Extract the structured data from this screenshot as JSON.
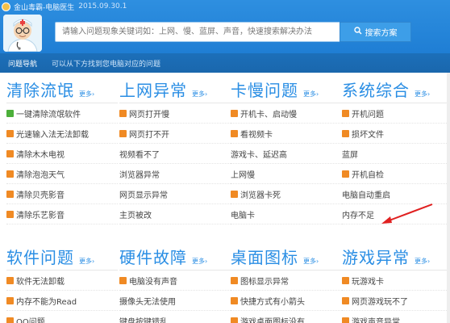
{
  "window": {
    "title": "金山毒霸-电脑医生",
    "version": "2015.09.30.1"
  },
  "search": {
    "placeholder": "请输入问题现象关键词如：上网、慢、蓝屏、声音，快速搜索解决办法",
    "button_label": "搜索方案"
  },
  "navbar": {
    "tab_label": "问题导航",
    "hint": "可以从下方找到您电脑对应的问题"
  },
  "more_label": "更多",
  "colors": {
    "accent": "#2a8ee4",
    "header": "#2e8fe0",
    "navbar": "#1c6fb9",
    "badge_orange": "#f08a24",
    "badge_green": "#4caf3a",
    "arrow": "#e02020"
  },
  "categories": [
    {
      "title": "清除流氓",
      "items": [
        {
          "label": "一键清除流氓软件",
          "badge": "green"
        },
        {
          "label": "光速输入法无法卸载",
          "badge": "orange"
        },
        {
          "label": "清除木木电视",
          "badge": "orange"
        },
        {
          "label": "清除泡泡天气",
          "badge": "orange"
        },
        {
          "label": "清除贝壳影音",
          "badge": "orange"
        },
        {
          "label": "清除乐艺影音",
          "badge": "orange"
        }
      ]
    },
    {
      "title": "上网异常",
      "items": [
        {
          "label": "网页打开慢",
          "badge": "orange"
        },
        {
          "label": "网页打不开",
          "badge": "orange"
        },
        {
          "label": "视频看不了",
          "badge": "none"
        },
        {
          "label": "浏览器异常",
          "badge": "none"
        },
        {
          "label": "网页显示异常",
          "badge": "none"
        },
        {
          "label": "主页被改",
          "badge": "none"
        }
      ]
    },
    {
      "title": "卡慢问题",
      "items": [
        {
          "label": "开机卡、启动慢",
          "badge": "orange"
        },
        {
          "label": "看视频卡",
          "badge": "orange"
        },
        {
          "label": "游戏卡、延迟高",
          "badge": "none"
        },
        {
          "label": "上网慢",
          "badge": "none"
        },
        {
          "label": "浏览器卡死",
          "badge": "orange"
        },
        {
          "label": "电脑卡",
          "badge": "none"
        }
      ]
    },
    {
      "title": "系统综合",
      "items": [
        {
          "label": "开机问题",
          "badge": "orange"
        },
        {
          "label": "损坏文件",
          "badge": "orange"
        },
        {
          "label": "蓝屏",
          "badge": "none"
        },
        {
          "label": "开机自检",
          "badge": "orange"
        },
        {
          "label": "电脑自动重启",
          "badge": "none"
        },
        {
          "label": "内存不足",
          "badge": "none"
        }
      ]
    },
    {
      "title": "软件问题",
      "items": [
        {
          "label": "软件无法卸载",
          "badge": "orange"
        },
        {
          "label": "内存不能为Read",
          "badge": "orange"
        },
        {
          "label": "QQ问题",
          "badge": "orange"
        }
      ]
    },
    {
      "title": "硬件故障",
      "items": [
        {
          "label": "电脑没有声音",
          "badge": "orange"
        },
        {
          "label": "摄像头无法使用",
          "badge": "none"
        },
        {
          "label": "键盘按键错乱",
          "badge": "none"
        }
      ]
    },
    {
      "title": "桌面图标",
      "items": [
        {
          "label": "图标显示异常",
          "badge": "orange"
        },
        {
          "label": "快捷方式有小箭头",
          "badge": "orange"
        },
        {
          "label": "游戏桌面图标没有",
          "badge": "orange"
        }
      ]
    },
    {
      "title": "游戏异常",
      "items": [
        {
          "label": "玩游戏卡",
          "badge": "orange"
        },
        {
          "label": "网页游戏玩不了",
          "badge": "orange"
        },
        {
          "label": "游戏声音异常",
          "badge": "orange"
        }
      ]
    }
  ]
}
